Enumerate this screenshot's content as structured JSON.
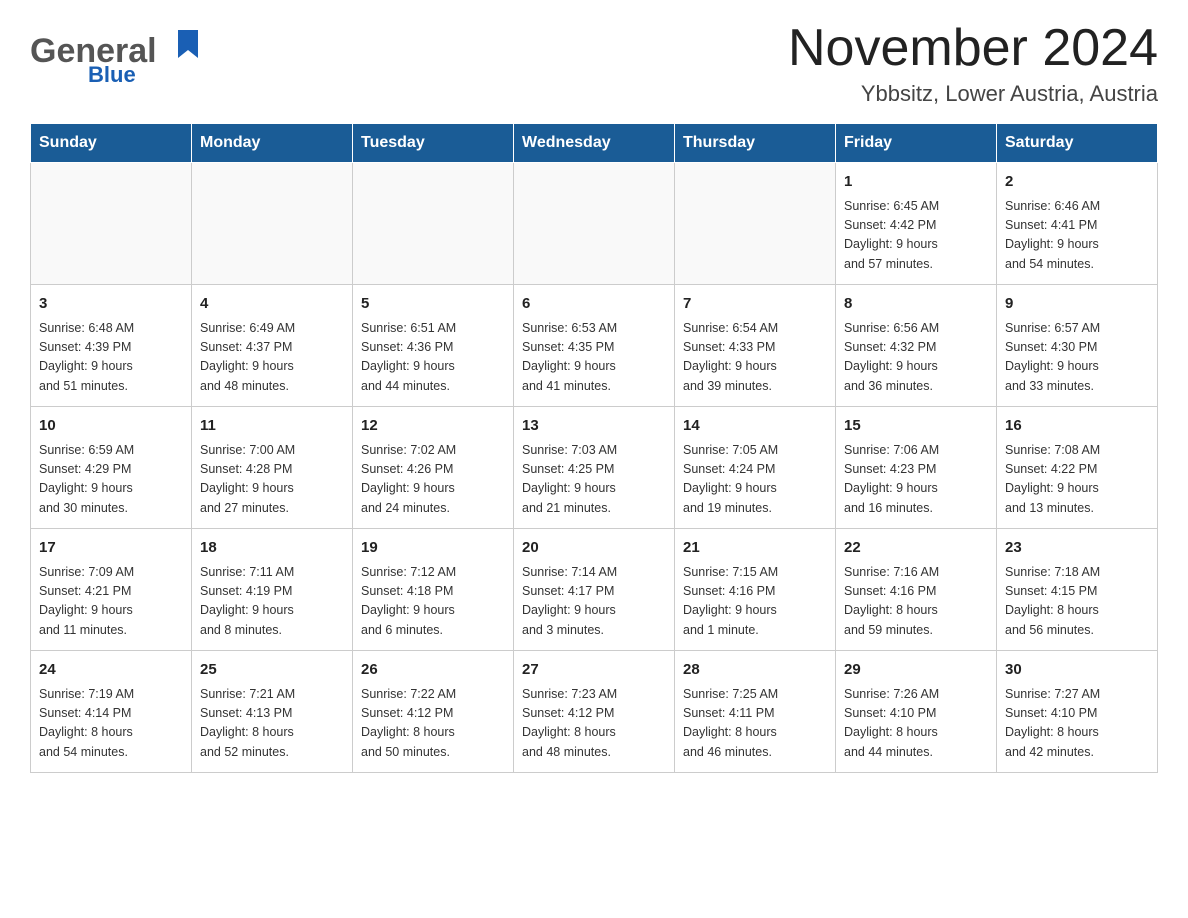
{
  "header": {
    "logo_general": "General",
    "logo_blue": "Blue",
    "title": "November 2024",
    "subtitle": "Ybbsitz, Lower Austria, Austria"
  },
  "days_of_week": [
    "Sunday",
    "Monday",
    "Tuesday",
    "Wednesday",
    "Thursday",
    "Friday",
    "Saturday"
  ],
  "weeks": [
    [
      {
        "day": "",
        "info": ""
      },
      {
        "day": "",
        "info": ""
      },
      {
        "day": "",
        "info": ""
      },
      {
        "day": "",
        "info": ""
      },
      {
        "day": "",
        "info": ""
      },
      {
        "day": "1",
        "info": "Sunrise: 6:45 AM\nSunset: 4:42 PM\nDaylight: 9 hours\nand 57 minutes."
      },
      {
        "day": "2",
        "info": "Sunrise: 6:46 AM\nSunset: 4:41 PM\nDaylight: 9 hours\nand 54 minutes."
      }
    ],
    [
      {
        "day": "3",
        "info": "Sunrise: 6:48 AM\nSunset: 4:39 PM\nDaylight: 9 hours\nand 51 minutes."
      },
      {
        "day": "4",
        "info": "Sunrise: 6:49 AM\nSunset: 4:37 PM\nDaylight: 9 hours\nand 48 minutes."
      },
      {
        "day": "5",
        "info": "Sunrise: 6:51 AM\nSunset: 4:36 PM\nDaylight: 9 hours\nand 44 minutes."
      },
      {
        "day": "6",
        "info": "Sunrise: 6:53 AM\nSunset: 4:35 PM\nDaylight: 9 hours\nand 41 minutes."
      },
      {
        "day": "7",
        "info": "Sunrise: 6:54 AM\nSunset: 4:33 PM\nDaylight: 9 hours\nand 39 minutes."
      },
      {
        "day": "8",
        "info": "Sunrise: 6:56 AM\nSunset: 4:32 PM\nDaylight: 9 hours\nand 36 minutes."
      },
      {
        "day": "9",
        "info": "Sunrise: 6:57 AM\nSunset: 4:30 PM\nDaylight: 9 hours\nand 33 minutes."
      }
    ],
    [
      {
        "day": "10",
        "info": "Sunrise: 6:59 AM\nSunset: 4:29 PM\nDaylight: 9 hours\nand 30 minutes."
      },
      {
        "day": "11",
        "info": "Sunrise: 7:00 AM\nSunset: 4:28 PM\nDaylight: 9 hours\nand 27 minutes."
      },
      {
        "day": "12",
        "info": "Sunrise: 7:02 AM\nSunset: 4:26 PM\nDaylight: 9 hours\nand 24 minutes."
      },
      {
        "day": "13",
        "info": "Sunrise: 7:03 AM\nSunset: 4:25 PM\nDaylight: 9 hours\nand 21 minutes."
      },
      {
        "day": "14",
        "info": "Sunrise: 7:05 AM\nSunset: 4:24 PM\nDaylight: 9 hours\nand 19 minutes."
      },
      {
        "day": "15",
        "info": "Sunrise: 7:06 AM\nSunset: 4:23 PM\nDaylight: 9 hours\nand 16 minutes."
      },
      {
        "day": "16",
        "info": "Sunrise: 7:08 AM\nSunset: 4:22 PM\nDaylight: 9 hours\nand 13 minutes."
      }
    ],
    [
      {
        "day": "17",
        "info": "Sunrise: 7:09 AM\nSunset: 4:21 PM\nDaylight: 9 hours\nand 11 minutes."
      },
      {
        "day": "18",
        "info": "Sunrise: 7:11 AM\nSunset: 4:19 PM\nDaylight: 9 hours\nand 8 minutes."
      },
      {
        "day": "19",
        "info": "Sunrise: 7:12 AM\nSunset: 4:18 PM\nDaylight: 9 hours\nand 6 minutes."
      },
      {
        "day": "20",
        "info": "Sunrise: 7:14 AM\nSunset: 4:17 PM\nDaylight: 9 hours\nand 3 minutes."
      },
      {
        "day": "21",
        "info": "Sunrise: 7:15 AM\nSunset: 4:16 PM\nDaylight: 9 hours\nand 1 minute."
      },
      {
        "day": "22",
        "info": "Sunrise: 7:16 AM\nSunset: 4:16 PM\nDaylight: 8 hours\nand 59 minutes."
      },
      {
        "day": "23",
        "info": "Sunrise: 7:18 AM\nSunset: 4:15 PM\nDaylight: 8 hours\nand 56 minutes."
      }
    ],
    [
      {
        "day": "24",
        "info": "Sunrise: 7:19 AM\nSunset: 4:14 PM\nDaylight: 8 hours\nand 54 minutes."
      },
      {
        "day": "25",
        "info": "Sunrise: 7:21 AM\nSunset: 4:13 PM\nDaylight: 8 hours\nand 52 minutes."
      },
      {
        "day": "26",
        "info": "Sunrise: 7:22 AM\nSunset: 4:12 PM\nDaylight: 8 hours\nand 50 minutes."
      },
      {
        "day": "27",
        "info": "Sunrise: 7:23 AM\nSunset: 4:12 PM\nDaylight: 8 hours\nand 48 minutes."
      },
      {
        "day": "28",
        "info": "Sunrise: 7:25 AM\nSunset: 4:11 PM\nDaylight: 8 hours\nand 46 minutes."
      },
      {
        "day": "29",
        "info": "Sunrise: 7:26 AM\nSunset: 4:10 PM\nDaylight: 8 hours\nand 44 minutes."
      },
      {
        "day": "30",
        "info": "Sunrise: 7:27 AM\nSunset: 4:10 PM\nDaylight: 8 hours\nand 42 minutes."
      }
    ]
  ]
}
